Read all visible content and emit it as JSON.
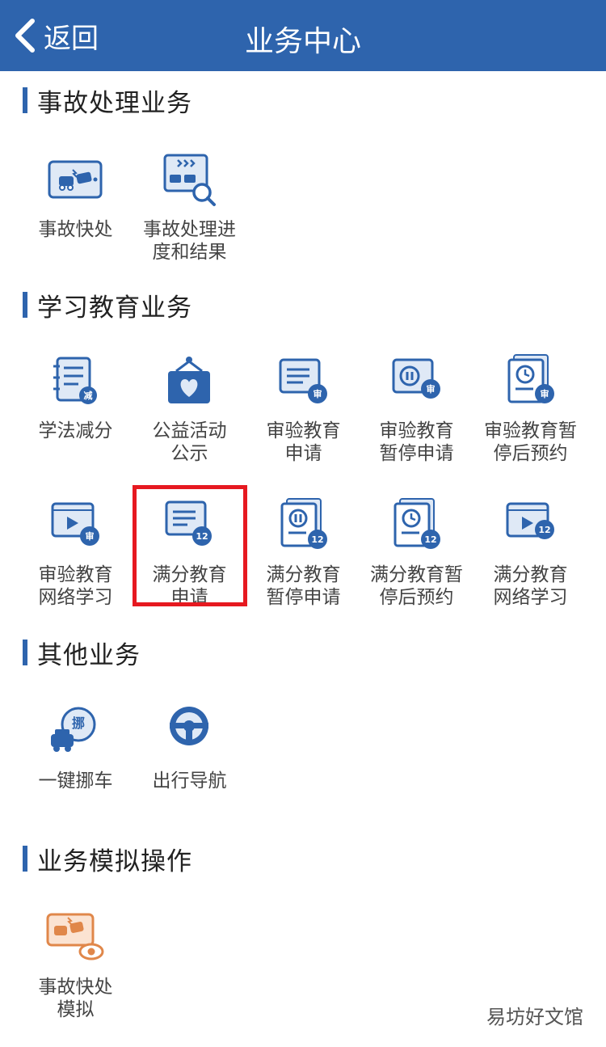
{
  "nav": {
    "back_label": "返回",
    "title": "业务中心",
    "bg_color": "#2e64ad"
  },
  "sections": {
    "accident": {
      "title": "事故处理业务",
      "items": [
        {
          "label": "事故快处",
          "icon": "car-crash-screen-icon"
        },
        {
          "label": "事故处理进\n度和结果",
          "icon": "crash-search-icon"
        }
      ]
    },
    "study": {
      "title": "学习教育业务",
      "items": [
        {
          "label": "学法减分",
          "icon": "notebook-reduce-icon",
          "badge": "减"
        },
        {
          "label": "公益活动\n公示",
          "icon": "charity-board-icon"
        },
        {
          "label": "审验教育\n申请",
          "icon": "review-document-icon",
          "badge": "审"
        },
        {
          "label": "审验教育\n暂停申请",
          "icon": "review-pause-icon",
          "badge": "审"
        },
        {
          "label": "审验教育暂\n停后预约",
          "icon": "review-clock-icon",
          "badge": "审"
        },
        {
          "label": "审验教育\n网络学习",
          "icon": "review-video-icon",
          "badge": "审"
        },
        {
          "label": "满分教育\n申请",
          "icon": "fullscore-document-icon",
          "badge": "12"
        },
        {
          "label": "满分教育\n暂停申请",
          "icon": "fullscore-pause-icon",
          "badge": "12"
        },
        {
          "label": "满分教育暂\n停后预约",
          "icon": "fullscore-clock-icon",
          "badge": "12"
        },
        {
          "label": "满分教育\n网络学习",
          "icon": "fullscore-video-icon",
          "badge": "12"
        }
      ]
    },
    "other": {
      "title": "其他业务",
      "items": [
        {
          "label": "一键挪车",
          "icon": "move-car-icon",
          "badge": "挪"
        },
        {
          "label": "出行导航",
          "icon": "steering-wheel-icon"
        }
      ]
    },
    "simulation": {
      "title": "业务模拟操作",
      "items": [
        {
          "label": "事故快处\n模拟",
          "icon": "crash-simulation-icon"
        }
      ]
    }
  },
  "colors": {
    "icon_blue": "#2e64ad",
    "icon_light": "#dfe9f6",
    "sim_orange": "#e0874a",
    "highlight_red": "#e61920"
  },
  "watermark": "易坊好文馆"
}
